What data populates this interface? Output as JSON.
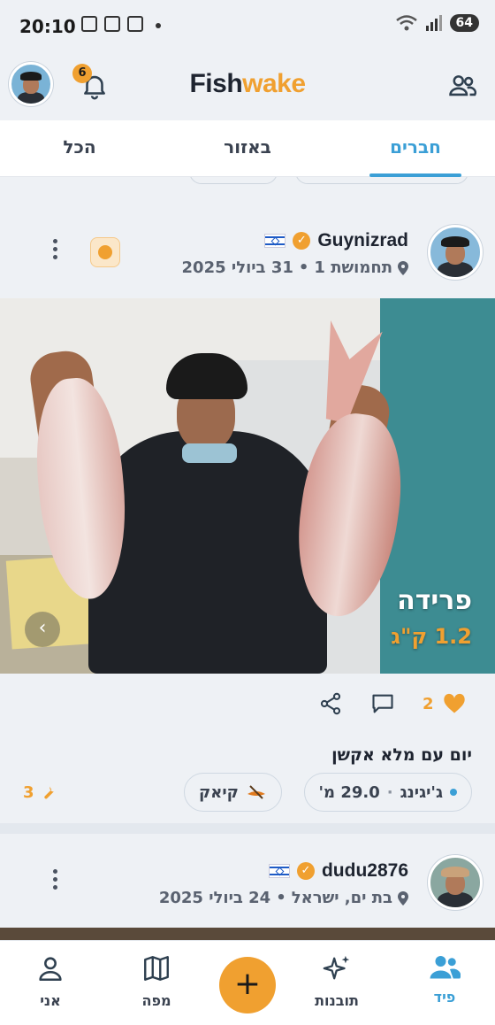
{
  "status_bar": {
    "time": "20:10",
    "battery": "64",
    "wifi_label": "5"
  },
  "header": {
    "logo_part1": "Fish",
    "logo_part2": "wake",
    "notifications_count": "6"
  },
  "tabs": [
    {
      "label": "חברים",
      "active": true
    },
    {
      "label": "באזור",
      "active": false
    },
    {
      "label": "הכל",
      "active": false
    }
  ],
  "posts": [
    {
      "username": "Guynizrad",
      "location": "תחמושת 1",
      "date": "31 ביולי 2025",
      "separator": "•",
      "species": "פרידה",
      "weight": "1.2 ק\"ג",
      "likes": "2",
      "caption": "יום עם מלא אקשן",
      "chips": {
        "method": "ג'יגינג",
        "depth": "29.0 מ'",
        "separator": "·",
        "vessel": "קיאק"
      },
      "gear_count": "3"
    },
    {
      "username": "dudu2876",
      "location": "בת ים, ישראל",
      "date": "24 ביולי 2025",
      "separator": "•"
    }
  ],
  "bottom_nav": [
    {
      "label": "פיד",
      "icon": "users-icon",
      "active": true
    },
    {
      "label": "תובנות",
      "icon": "sparkles-icon",
      "active": false
    },
    {
      "label": "מפה",
      "icon": "map-icon",
      "active": false
    },
    {
      "label": "אני",
      "icon": "person-icon",
      "active": false
    }
  ],
  "colors": {
    "accent": "#3b9fd6",
    "brand_orange": "#f0a030",
    "background": "#eef1f5"
  }
}
